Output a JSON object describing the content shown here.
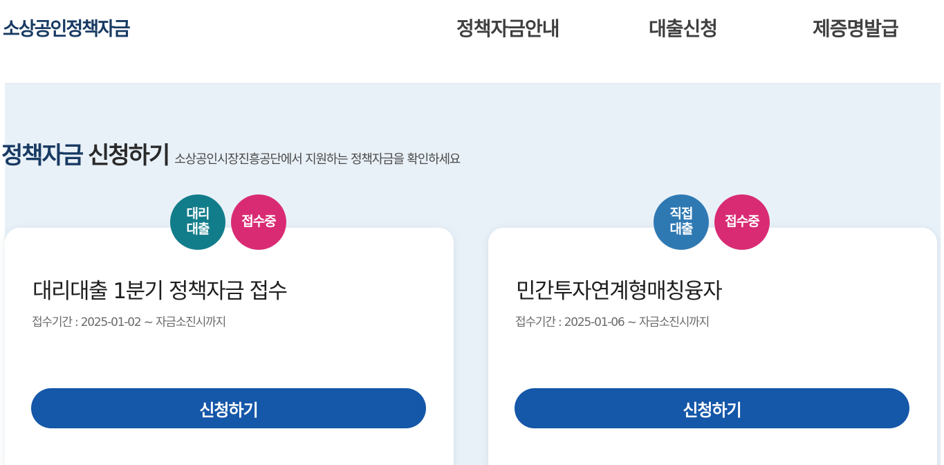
{
  "header": {
    "logo_text": "소상공인정책자금",
    "nav": [
      {
        "label": "정책자금안내"
      },
      {
        "label": "대출신청"
      },
      {
        "label": "제증명발급"
      }
    ]
  },
  "section": {
    "title_part1": "정책자금",
    "title_part2": "신청하기",
    "subtitle": "소상공인시장진흥공단에서 지원하는 정책자금을 확인하세요"
  },
  "cards": [
    {
      "type_badge_line1": "대리",
      "type_badge_line2": "대출",
      "status_badge": "접수중",
      "title": "대리대출 1분기 정책자금 접수",
      "period": "접수기간 : 2025-01-02 ~ 자금소진시까지",
      "button_label": "신청하기"
    },
    {
      "type_badge_line1": "직접",
      "type_badge_line2": "대출",
      "status_badge": "접수중",
      "title": "민간투자연계형매칭융자",
      "period": "접수기간 : 2025-01-06 ~ 자금소진시까지",
      "button_label": "신청하기"
    }
  ],
  "colors": {
    "primary_button": "#1557a8",
    "status_badge": "#d92b74",
    "proxy_loan_badge": "#127d8a",
    "direct_loan_badge": "#2f79b3",
    "section_background": "#e9f1f8",
    "logo_color": "#183a63"
  }
}
